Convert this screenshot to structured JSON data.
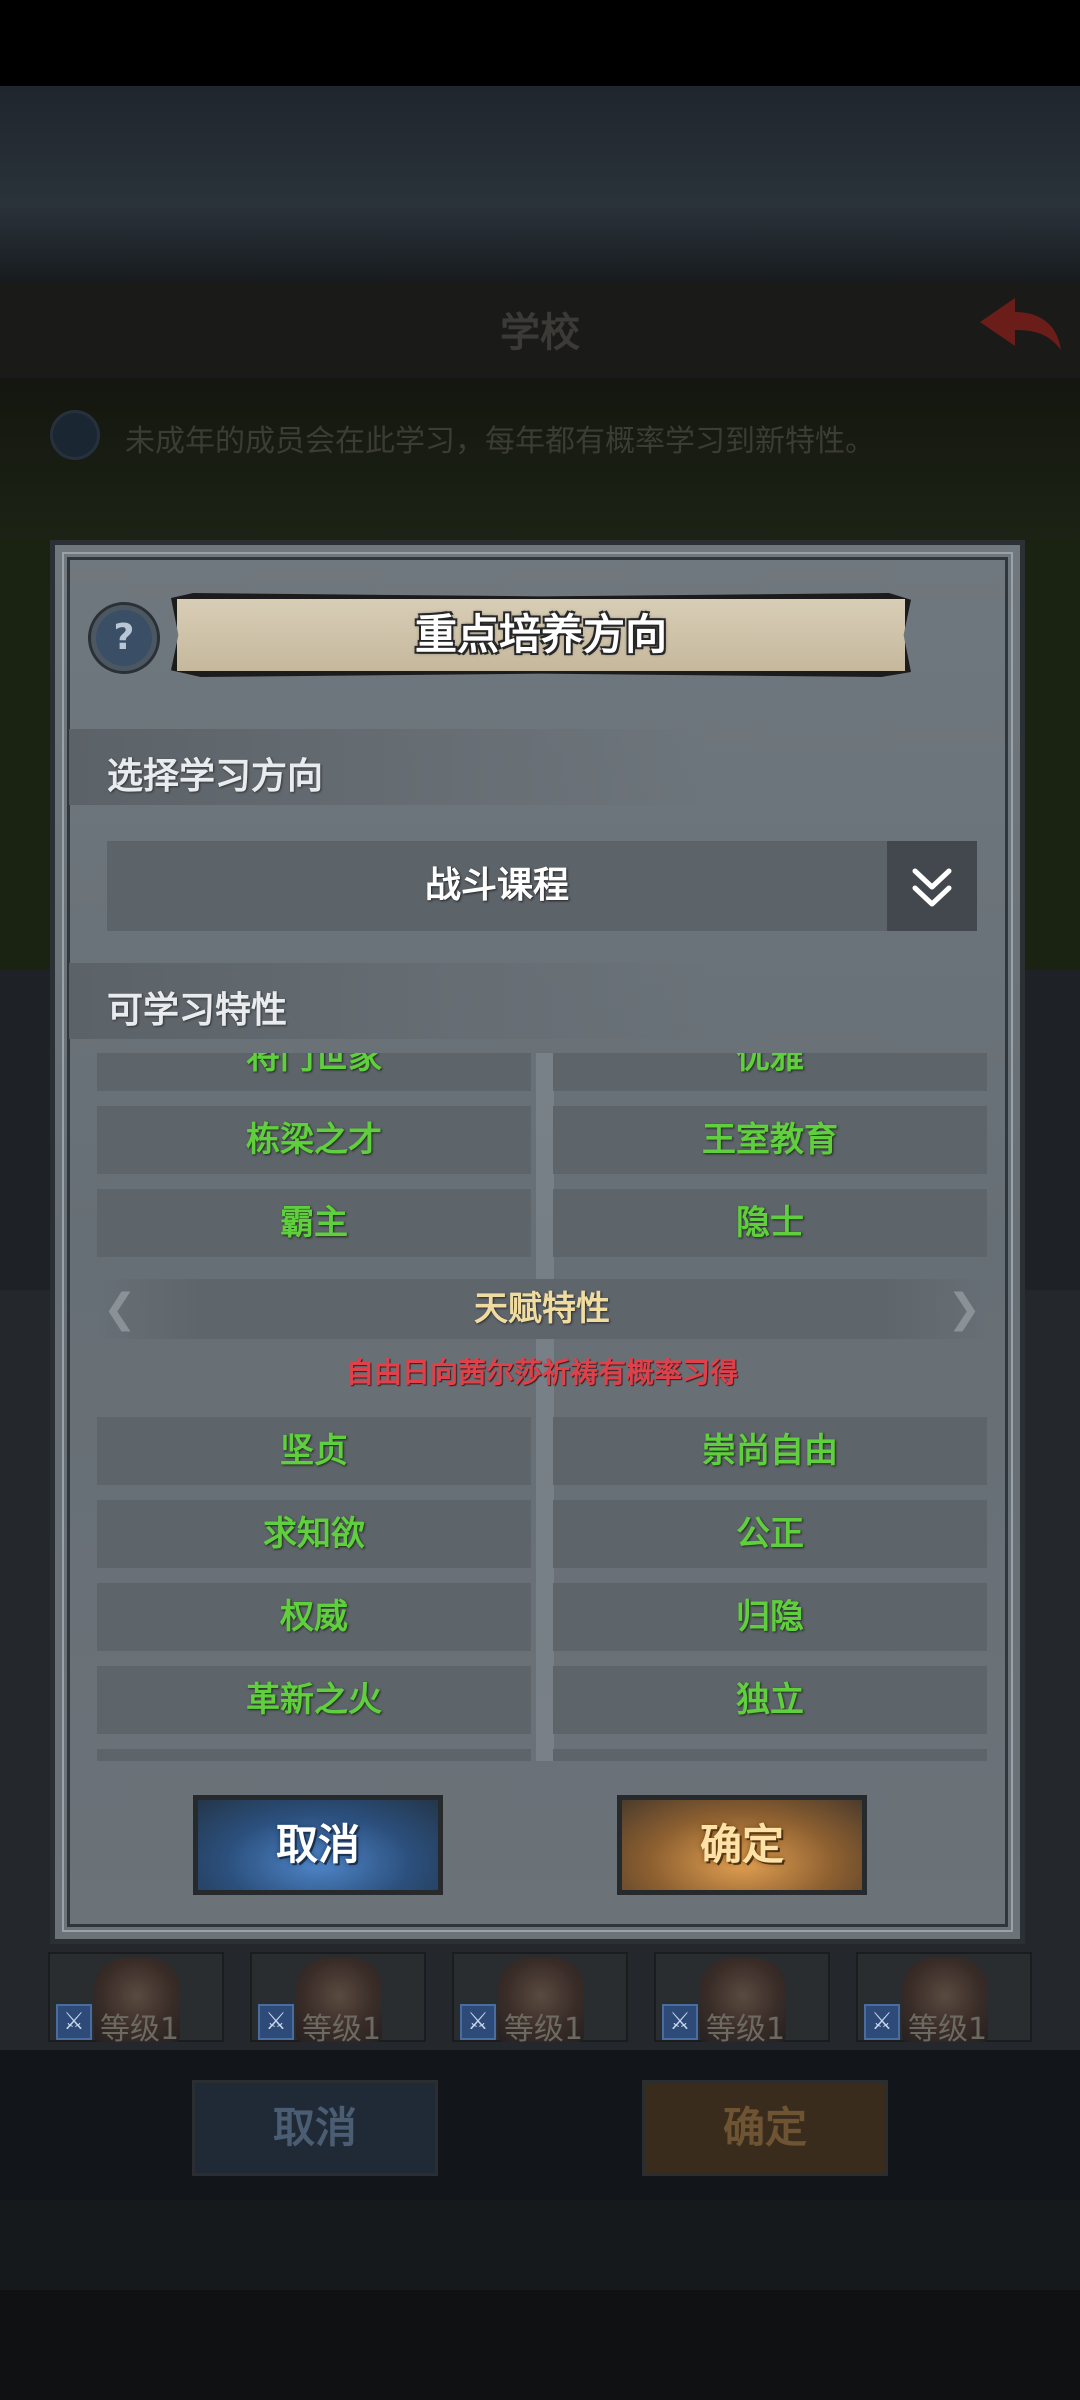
{
  "background": {
    "screen_title": "学校",
    "notice_text": "未成年的成员会在此学习，每年都有概率学习到新特性。",
    "members": [
      {
        "level": "等级1"
      },
      {
        "level": "等级1"
      },
      {
        "level": "等级1"
      },
      {
        "level": "等级1"
      },
      {
        "level": "等级1"
      }
    ],
    "cancel_label": "取消",
    "confirm_label": "确定"
  },
  "dialog": {
    "title": "重点培养方向",
    "help_icon": "question-mark-icon",
    "direction_section_label": "选择学习方向",
    "selected_direction": "战斗课程",
    "dropdown_icon": "double-chevron-down-icon",
    "learnable_section_label": "可学习特性",
    "learnable_traits": [
      "将门世家",
      "优雅",
      "栋梁之才",
      "王室教育",
      "霸主",
      "隐士"
    ],
    "talent_section_title": "天赋特性",
    "talent_note": "自由日向茜尔莎祈祷有概率习得",
    "talent_traits": [
      "坚贞",
      "崇尚自由",
      "求知欲",
      "公正",
      "权威",
      "归隐",
      "革新之火",
      "独立"
    ],
    "cancel_label": "取消",
    "confirm_label": "确定"
  },
  "colors": {
    "trait_text": "#5fcf3d",
    "talent_title": "#f0dca0",
    "talent_note": "#e0404a",
    "cancel_button": "#3c6aa4",
    "confirm_button": "#c8873f"
  }
}
